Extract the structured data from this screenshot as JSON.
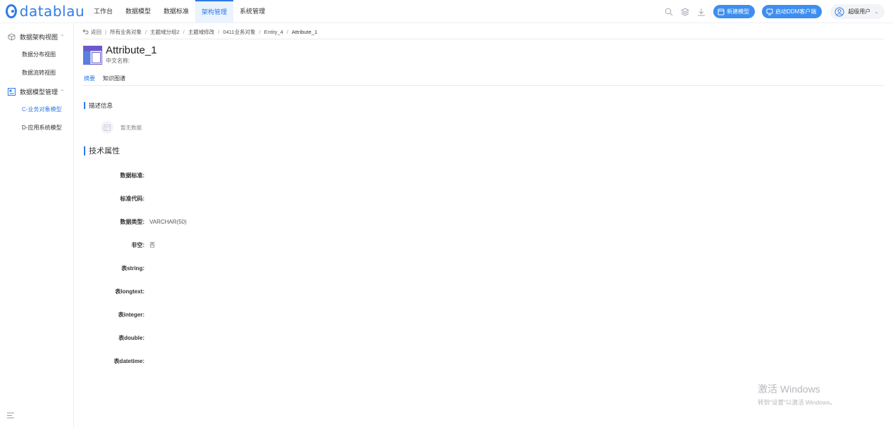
{
  "app": {
    "logo_text": "datablau",
    "brand_color": "#2f7be8"
  },
  "nav": {
    "items": [
      {
        "label": "工作台"
      },
      {
        "label": "数据模型"
      },
      {
        "label": "数据标准"
      },
      {
        "label": "架构管理",
        "active": true
      },
      {
        "label": "系统管理"
      }
    ]
  },
  "toolbar": {
    "new_model_label": "新建模型",
    "launch_ddm_label": "启动DDM客户端",
    "user_label": "超级用户",
    "icons": [
      "search-icon",
      "layers-icon",
      "download-icon"
    ]
  },
  "sidebar": {
    "groups": [
      {
        "label": "数据架构视图",
        "icon": "cube-icon",
        "items": [
          {
            "label": "数据分布视图"
          },
          {
            "label": "数据流转视图"
          }
        ]
      },
      {
        "label": "数据模型管理",
        "icon": "model-icon",
        "items": [
          {
            "label": "C-业务对象模型",
            "active": true
          },
          {
            "label": "D-应用系统模型"
          }
        ]
      }
    ]
  },
  "breadcrumb": {
    "back_label": "返回",
    "items": [
      "所有业务对象",
      "主题域分组2",
      "主题域修改",
      "0411业务对象",
      "Entity_4",
      "Attribute_1"
    ]
  },
  "header": {
    "title": "Attribute_1",
    "subtitle": "中文名称:"
  },
  "tabs": [
    {
      "label": "摘要",
      "active": true
    },
    {
      "label": "知识图谱"
    }
  ],
  "description": {
    "title": "描述信息",
    "empty_text": "暂无数据"
  },
  "tech": {
    "title": "技术属性",
    "props": [
      {
        "key": "数据标准:",
        "value": ""
      },
      {
        "key": "标准代码:",
        "value": ""
      },
      {
        "key": "数据类型:",
        "value": "VARCHAR(50)"
      },
      {
        "key": "非空:",
        "value": "否"
      },
      {
        "key": "表string:",
        "value": ""
      },
      {
        "key": "表longtext:",
        "value": ""
      },
      {
        "key": "表integer:",
        "value": ""
      },
      {
        "key": "表double:",
        "value": ""
      },
      {
        "key": "表datetime:",
        "value": ""
      }
    ]
  },
  "watermark": {
    "line1": "激活 Windows",
    "line2": "转到\"设置\"以激活 Windows。"
  }
}
